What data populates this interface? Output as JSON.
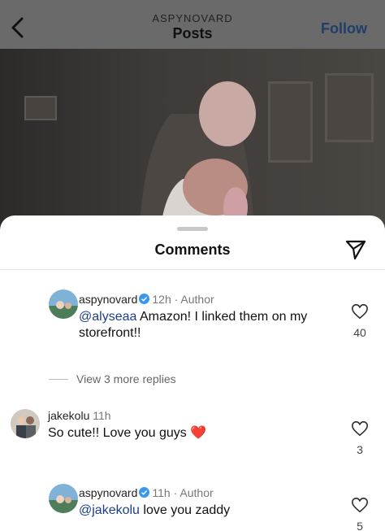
{
  "header": {
    "username": "ASPYNOVARD",
    "title": "Posts",
    "follow_label": "Follow"
  },
  "sheet": {
    "title": "Comments"
  },
  "comments": [
    {
      "username": "aspynovard",
      "verified": true,
      "time": "12h",
      "role": "Author",
      "mention": "@alyseaa",
      "text_line1": "Amazon! I linked them on my",
      "text_line2": "storefront!!",
      "likes": "40"
    },
    {
      "view_replies": "View 3 more replies"
    },
    {
      "username": "jakekolu",
      "time": "11h",
      "text": "So cute!! Love you guys",
      "emoji": "❤️",
      "likes": "3"
    },
    {
      "username": "aspynovard",
      "verified": true,
      "time": "11h",
      "role": "Author",
      "mention": "@jakekolu",
      "text": "love you zaddy",
      "likes": "5"
    }
  ],
  "icons": {
    "back": "chevron-left-icon",
    "send": "paper-plane-icon",
    "like": "heart-outline-icon",
    "verified": "verified-badge-icon"
  },
  "colors": {
    "follow": "#1f3f69",
    "mention": "#1b3f8a",
    "verified": "#3897f0",
    "heart_emoji": "#e0245e"
  }
}
